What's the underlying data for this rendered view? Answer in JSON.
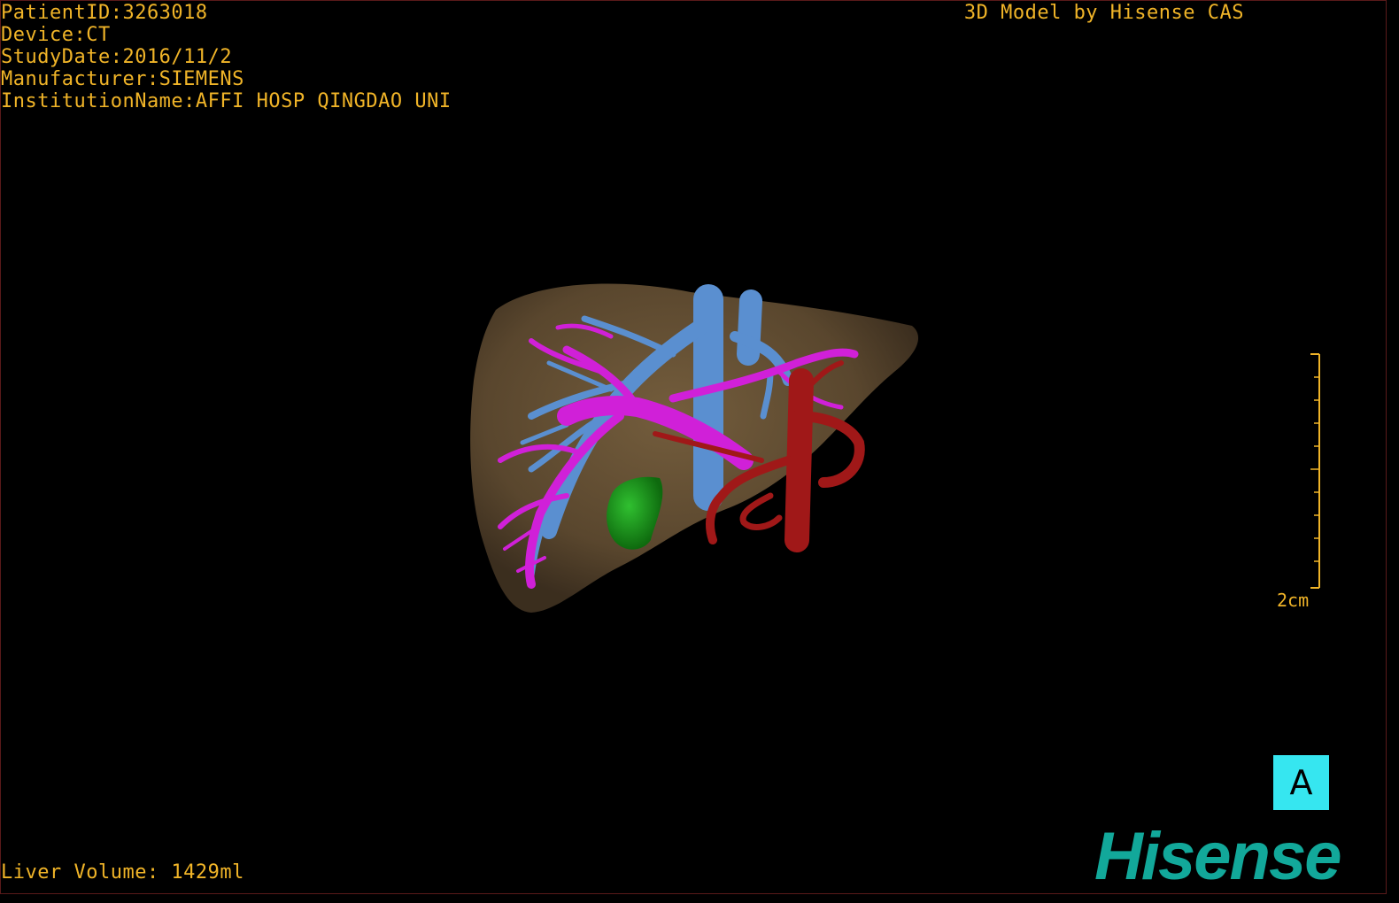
{
  "header": {
    "patient_id": "PatientID:3263018",
    "device": "Device:CT",
    "study_date": "StudyDate:2016/11/2",
    "manufacturer": "Manufacturer:SIEMENS",
    "institution": "InstitutionName:AFFI HOSP QINGDAO UNI",
    "credit": "3D Model by Hisense CAS"
  },
  "footer": {
    "liver_volume": "Liver Volume: 1429ml"
  },
  "scale": {
    "label": "2cm"
  },
  "orientation": {
    "label": "A"
  },
  "logo": {
    "text": "Hisense"
  },
  "colors": {
    "overlay_text": "#f0b428",
    "liver": "#6b5638",
    "portal_vein": "#d020d8",
    "hepatic_vein": "#5a8fd0",
    "artery": "#a01818",
    "gallbladder": "#1f9a1f",
    "orientation_cube": "#36e6f0",
    "logo": "#12a89a"
  },
  "model_structures": [
    "liver",
    "portal-vein",
    "hepatic-vein",
    "hepatic-artery",
    "gallbladder"
  ]
}
